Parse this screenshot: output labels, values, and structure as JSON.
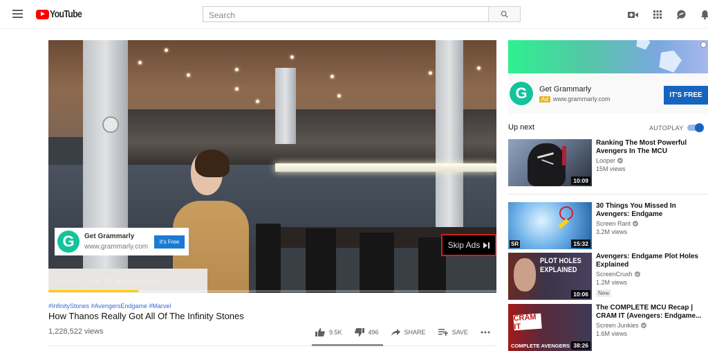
{
  "header": {
    "logo_text": "YouTube",
    "search_placeholder": "Search",
    "icons": [
      "menu-icon",
      "create-video-icon",
      "apps-icon",
      "messages-icon",
      "notifications-icon"
    ]
  },
  "player": {
    "overlay_ad": {
      "title": "Get Grammarly",
      "url": "www.grammarly.com",
      "button_label": "It's Free",
      "logo_letter": "G"
    },
    "ad_info": "Ad 1 of 2 · 0:46",
    "ad_domain": "grammarly.com",
    "skip_label": "Skip Ads",
    "ad_progress_percent": 20,
    "colors": {
      "skip_border": "#d51c1c",
      "progress": "#ffcc00"
    }
  },
  "video": {
    "hashtags": "#InfinityStones #AvengersEndgame #Marvel",
    "title": "How Thanos Really Got All Of The Infinity Stones",
    "views": "1,228,522 views",
    "likes": "9.5K",
    "dislikes": "496",
    "share_label": "SHARE",
    "save_label": "SAVE",
    "like_ratio_percent": 95
  },
  "sidebar": {
    "ad": {
      "title": "Get Grammarly",
      "badge": "Ad",
      "url": "www.grammarly.com",
      "button_label": "IT'S FREE",
      "logo_letter": "G"
    },
    "upnext_label": "Up next",
    "autoplay_label": "AUTOPLAY",
    "autoplay_on": true,
    "items": [
      {
        "title": "Ranking The Most Powerful Avengers In The MCU",
        "channel": "Looper",
        "views": "15M views",
        "duration": "10:09",
        "badge": ""
      },
      {
        "title": "30 Things You Missed In Avengers: Endgame",
        "channel": "Screen Rant",
        "views": "3.2M views",
        "duration": "15:32",
        "badge": "",
        "thumb_text": "SR"
      },
      {
        "title": "Avengers: Endgame Plot Holes Explained",
        "channel": "ScreenCrush",
        "views": "1.2M views",
        "duration": "10:06",
        "badge": "New",
        "thumb_text": "PLOT HOLES EXPLAINED"
      },
      {
        "title": "The COMPLETE MCU Recap | CRAM IT (Avengers: Endgame...",
        "channel": "Screen Junkies",
        "views": "1.6M views",
        "duration": "38:26",
        "badge": "",
        "thumb_text": "CRAM IT",
        "thumb_sub": "COMPLETE AVENGERS"
      }
    ]
  }
}
